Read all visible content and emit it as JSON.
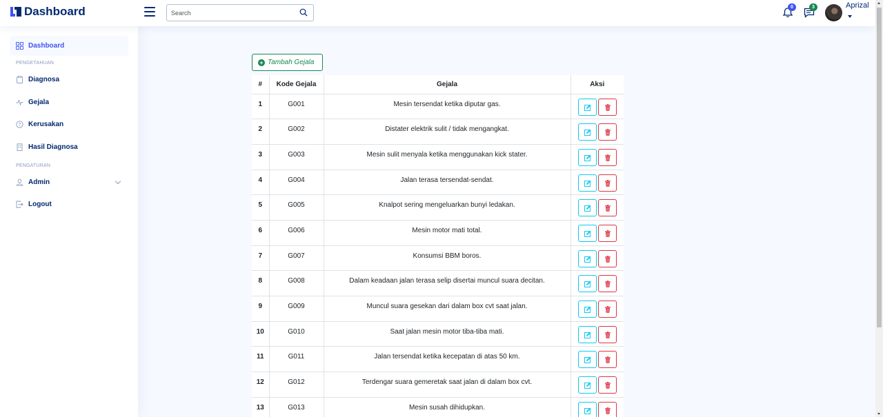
{
  "header": {
    "logo_text": "Dashboard",
    "search_placeholder": "Search",
    "notifications_count": "0",
    "messages_count": "3",
    "username": "Aprizal",
    "accent_color": "#4154f1",
    "notification_badge_color": "#4154f1",
    "message_badge_color": "#198754"
  },
  "sidebar": {
    "items": [
      {
        "label": "Dashboard",
        "icon": "grid-icon",
        "active": true
      },
      {
        "label": "Diagnosa",
        "icon": "clipboard-icon"
      },
      {
        "label": "Gejala",
        "icon": "pulse-icon"
      },
      {
        "label": "Kerusakan",
        "icon": "question-circle-icon"
      },
      {
        "label": "Hasil Diagnosa",
        "icon": "building-icon"
      },
      {
        "label": "Admin",
        "icon": "person-icon"
      },
      {
        "label": "Logout",
        "icon": "box-arrow-right-icon"
      }
    ],
    "headings": [
      "PENGETAHUAN",
      "PENGATURAN"
    ]
  },
  "main": {
    "add_button_label": "Tambah Gejala",
    "table": {
      "columns": [
        "#",
        "Kode Gejala",
        "Gejala",
        "Aksi"
      ],
      "rows": [
        [
          "1",
          "G001",
          "Mesin tersendat ketika diputar gas."
        ],
        [
          "2",
          "G002",
          "Distater elektrik sulit / tidak mengangkat."
        ],
        [
          "3",
          "G003",
          "Mesin sulit menyala ketika menggunakan kick stater."
        ],
        [
          "4",
          "G004",
          "Jalan terasa tersendat-sendat."
        ],
        [
          "5",
          "G005",
          "Knalpot sering mengeluarkan bunyi ledakan."
        ],
        [
          "6",
          "G006",
          "Mesin motor mati total."
        ],
        [
          "7",
          "G007",
          "Konsumsi BBM boros."
        ],
        [
          "8",
          "G008",
          "Dalam keadaan jalan terasa selip disertai muncul suara decitan."
        ],
        [
          "9",
          "G009",
          "Muncul suara gesekan dari dalam box cvt saat jalan."
        ],
        [
          "10",
          "G010",
          "Saat jalan mesin motor tiba-tiba mati."
        ],
        [
          "11",
          "G011",
          "Jalan tersendat ketika kecepatan di atas 50 km."
        ],
        [
          "12",
          "G012",
          "Terdengar suara gemeretak saat jalan di dalam box cvt."
        ],
        [
          "13",
          "G013",
          "Mesin susah dihidupkan."
        ]
      ]
    }
  }
}
